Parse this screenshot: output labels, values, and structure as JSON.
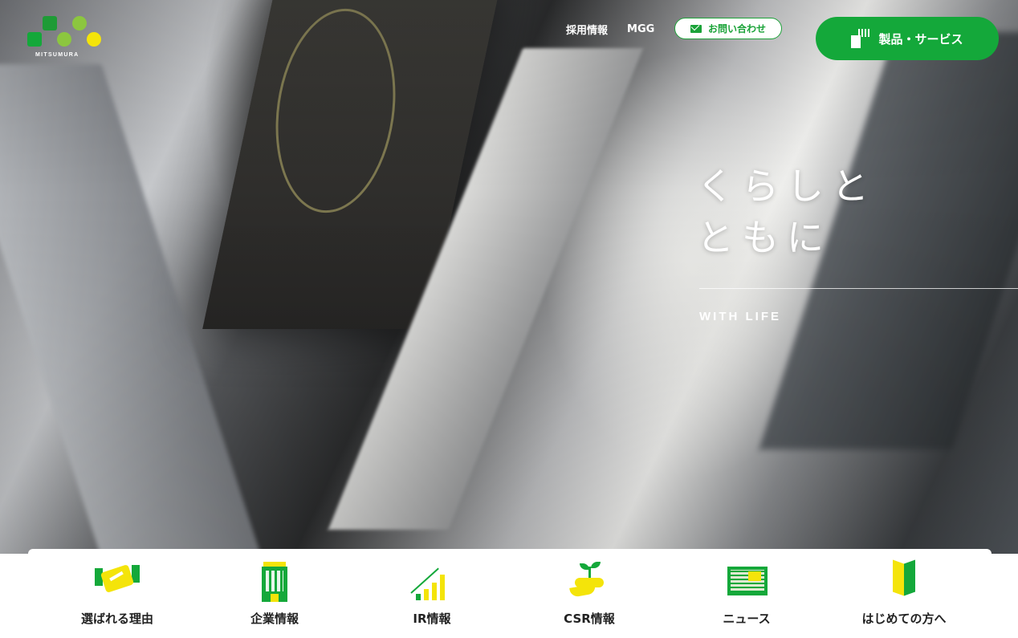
{
  "brand": {
    "name": "MITSUMURA",
    "colors": {
      "green": "#14a83a",
      "light_green": "#8cc63f",
      "yellow": "#f4e40a",
      "dark_green": "#1e8f32"
    }
  },
  "header": {
    "nav": [
      {
        "label": "採用情報"
      },
      {
        "label": "MGG"
      }
    ],
    "contact": {
      "label": "お問い合わせ",
      "icon": "mail-icon"
    },
    "products": {
      "label": "製品・サービス",
      "icon": "product-machine-icon"
    }
  },
  "hero": {
    "tagline_lines": [
      "くらしと",
      "ともに"
    ],
    "subtitle": "WITH LIFE"
  },
  "bottom_menu": [
    {
      "label": "選ばれる理由",
      "icon": "handshake-icon"
    },
    {
      "label": "企業情報",
      "icon": "building-icon"
    },
    {
      "label": "IR情報",
      "icon": "growth-chart-icon"
    },
    {
      "label": "CSR情報",
      "icon": "sprout-hand-icon"
    },
    {
      "label": "ニュース",
      "icon": "newspaper-icon"
    },
    {
      "label": "はじめての方へ",
      "icon": "beginner-mark-icon"
    }
  ]
}
